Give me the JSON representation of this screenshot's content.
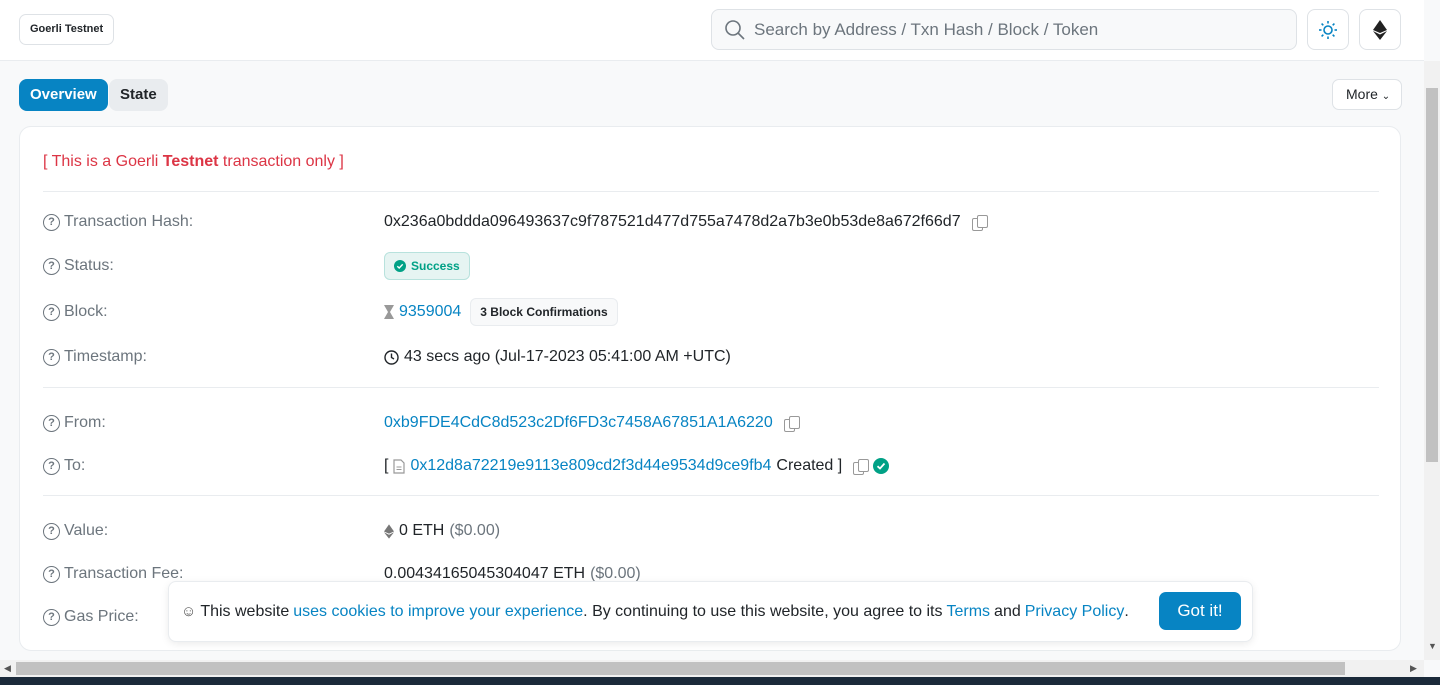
{
  "header": {
    "network": "Goerli Testnet",
    "search_placeholder": "Search by Address / Txn Hash / Block / Token"
  },
  "tabs": [
    {
      "label": "Overview",
      "active": true
    },
    {
      "label": "State",
      "active": false
    }
  ],
  "more_label": "More",
  "notice": {
    "pre": "[ This is a Goerli ",
    "bold": "Testnet",
    "post": " transaction only ]"
  },
  "rows": {
    "hash": {
      "label": "Transaction Hash:",
      "value": "0x236a0bddda096493637c9f787521d477d755a7478d2a7b3e0b53de8a672f66d7"
    },
    "status": {
      "label": "Status:",
      "value": "Success"
    },
    "block": {
      "label": "Block:",
      "value": "9359004",
      "confirmations": "3 Block Confirmations"
    },
    "timestamp": {
      "label": "Timestamp:",
      "value": "43 secs ago (Jul-17-2023 05:41:00 AM +UTC)"
    },
    "from": {
      "label": "From:",
      "value": "0xb9FDE4CdC8d523c2Df6FD3c7458A67851A1A6220"
    },
    "to": {
      "label": "To:",
      "open": "[",
      "value": "0x12d8a72219e9113e809cd2f3d44e9534d9ce9fb4",
      "created": "Created ]"
    },
    "value": {
      "label": "Value:",
      "value": "0 ETH",
      "usd": "($0.00)"
    },
    "fee": {
      "label": "Transaction Fee:",
      "value": "0.00434165045304047 ETH",
      "usd": "($0.00)"
    },
    "gas": {
      "label": "Gas Price:"
    }
  },
  "cookie": {
    "t1": "This website",
    "l1": "uses cookies to improve your experience",
    "t2": ". By continuing to use this website, you agree to its",
    "l2": "Terms",
    "t3": "and",
    "l3": "Privacy Policy",
    "t4": ".",
    "button": "Got it!"
  },
  "colors": {
    "accent": "#0784c3",
    "success": "#00a186",
    "danger": "#dc3545"
  }
}
